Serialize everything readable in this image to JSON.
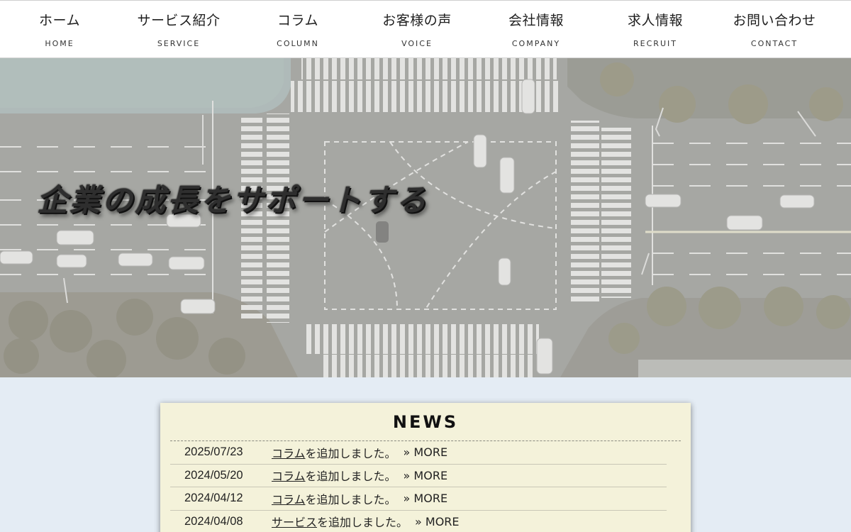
{
  "nav": {
    "items": [
      {
        "jp": "ホーム",
        "en": "HOME"
      },
      {
        "jp": "サービス紹介",
        "en": "SERVICE"
      },
      {
        "jp": "コラム",
        "en": "COLUMN"
      },
      {
        "jp": "お客様の声",
        "en": "VOICE"
      },
      {
        "jp": "会社情報",
        "en": "COMPANY"
      },
      {
        "jp": "求人情報",
        "en": "RECRUIT"
      },
      {
        "jp": "お問い合わせ",
        "en": "CONTACT"
      }
    ]
  },
  "hero": {
    "title": "企業の成長をサポートする"
  },
  "news": {
    "title": "NEWS",
    "items": [
      {
        "date": "2025/07/23",
        "link": "コラム",
        "text": "を追加しました。",
        "more": "» MORE"
      },
      {
        "date": "2024/05/20",
        "link": "コラム",
        "text": "を追加しました。",
        "more": "» MORE"
      },
      {
        "date": "2024/04/12",
        "link": "コラム",
        "text": "を追加しました。",
        "more": "» MORE"
      },
      {
        "date": "2024/04/08",
        "link": "サービス",
        "text": "を追加しました。",
        "more": "» MORE"
      }
    ]
  },
  "colors": {
    "page_bg": "#e4ecf4",
    "news_bg": "#f4f2da",
    "nav_bg": "#ffffff"
  }
}
